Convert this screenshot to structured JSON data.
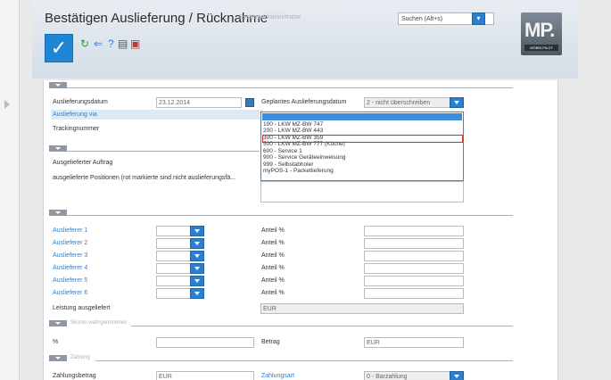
{
  "header": {
    "title": "Bestätigen Auslieferung / Rücknahme",
    "subtitle": "Systemadministrator",
    "search_placeholder": "Suchen (Alt+s)",
    "logo_text": "MP.",
    "logo_sub": "MÖBELPILOT"
  },
  "toolbar": {
    "ok_icon": "check-icon",
    "icons": [
      "refresh-icon",
      "back-icon",
      "help-icon",
      "print-icon",
      "pdf-icon"
    ]
  },
  "section1": {
    "auslieferungsdatum_label": "Auslieferungsdatum",
    "auslieferungsdatum_value": "23.12.2014",
    "geplantes_label": "Geplantes Auslieferungsdatum",
    "geplantes_value": "2 - nicht überschreiben",
    "via_label": "Auslieferung via",
    "tracking_label": "Trackingnummer"
  },
  "dropdown": {
    "items": [
      "100 - LKW MZ-BW 747",
      "200 - LKW MZ-BW 443",
      "300 - LKW MZ-BW 359",
      "500 - LKW MZ-BW 777 (Küche)",
      "600 - Service 1",
      "900 - Service Geräteeinweisung",
      "999 - Selbstabholer",
      "myPOS-1 - Packetlieferung"
    ],
    "highlighted_index": 2
  },
  "section2": {
    "auftrag_label": "Ausgelieferter Auftrag",
    "positionen_label": "ausgelieferte Positionen (rot markierte sind nicht auslieferungsfä..."
  },
  "section3": {
    "auslieferer": [
      "Auslieferer 1",
      "Auslieferer 2",
      "Auslieferer 3",
      "Auslieferer 4",
      "Auslieferer 5",
      "Auslieferer 6"
    ],
    "anteil_label": "Anteil %",
    "leistung_label": "Leistung ausgeliefert",
    "leistung_value": "EUR"
  },
  "section4": {
    "header": "Skonto wahrgenommen",
    "percent_label": "%",
    "betrag_label": "Betrag",
    "betrag_value": "EUR"
  },
  "section5": {
    "header": "Zahlung",
    "zahlungsbetrag_label": "Zahlungsbetrag",
    "zahlungsbetrag_value": "EUR",
    "zahlungsart_label": "Zahlungsart",
    "zahlungsart_value": "0 - Barzahlung"
  }
}
